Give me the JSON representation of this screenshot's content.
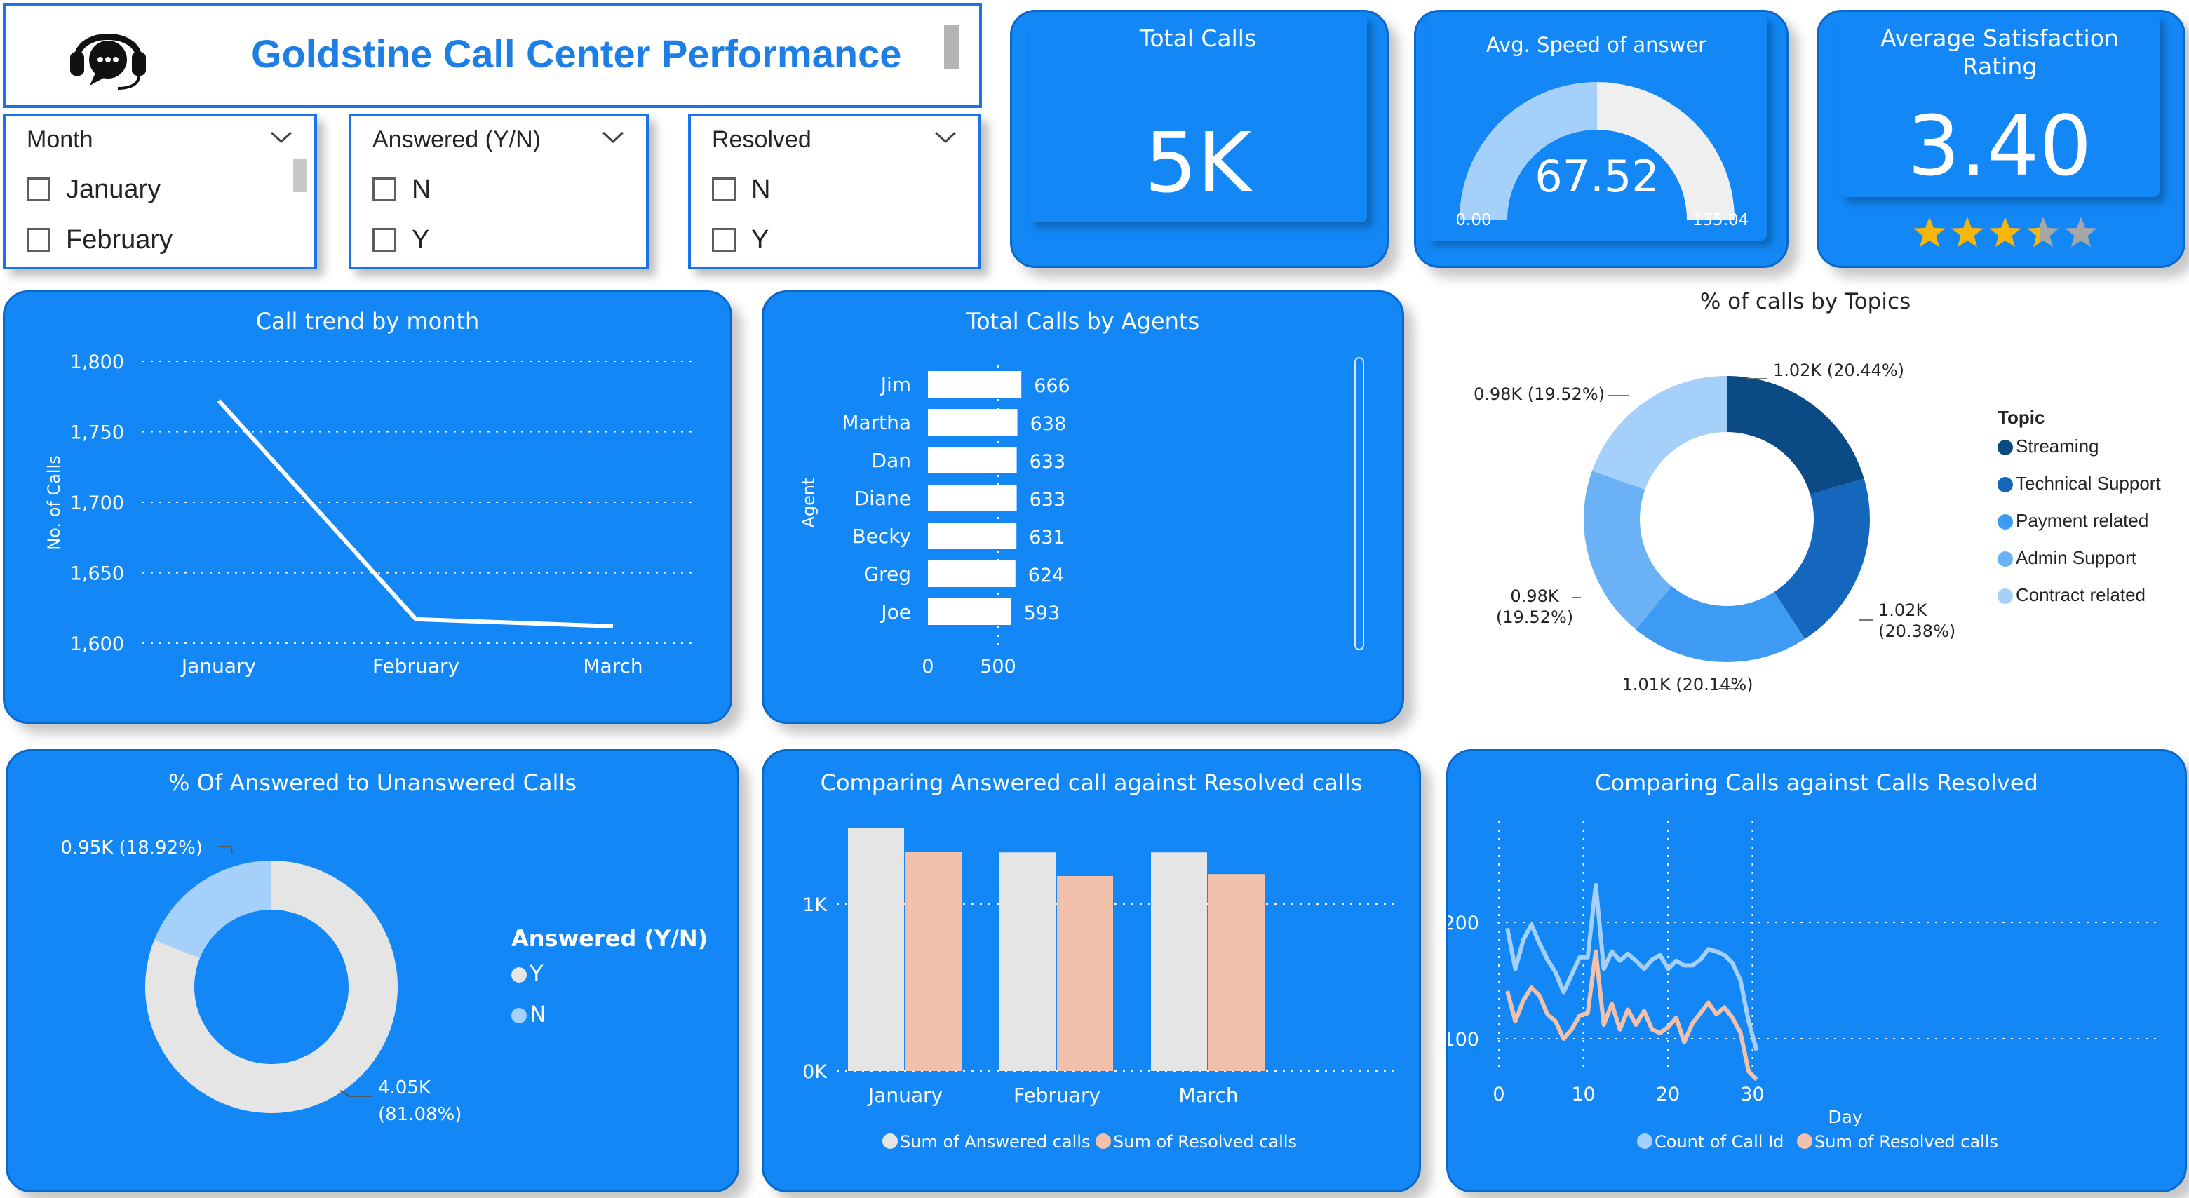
{
  "header": {
    "title": "Goldstine Call Center Performance",
    "logo_icon": "headset-chat-icon"
  },
  "slicers": {
    "month": {
      "title": "Month",
      "options": [
        "January",
        "February"
      ]
    },
    "answered": {
      "title": "Answered (Y/N)",
      "options": [
        "N",
        "Y"
      ]
    },
    "resolved": {
      "title": "Resolved",
      "options": [
        "N",
        "Y"
      ]
    }
  },
  "kpis": {
    "total_calls": {
      "title": "Total Calls",
      "value": "5K"
    },
    "speed": {
      "title": "Avg. Speed of answer",
      "value": "67.52",
      "min": "0.00",
      "max": "135.04",
      "fill_fraction": 0.5
    },
    "satisfaction": {
      "title_line1": "Average Satisfaction",
      "title_line2": "Rating",
      "value": "3.40",
      "stars_filled": 3.4,
      "stars_total": 5
    }
  },
  "colors": {
    "card_blue": "#1287f5",
    "streaming": "#0b4a84",
    "technical_support": "#1467bd",
    "payment_related": "#3e9bf3",
    "admin_support": "#6ab1f6",
    "contract_related": "#a5d0fa",
    "answered_y": "#e5e5e5",
    "answered_n": "#a5d0fa",
    "resolved_bar": "#f2c1ac",
    "count_line": "#a5d0fa",
    "resolved_line": "#f2c1ac",
    "star": "#f5b60e"
  },
  "chart_data": [
    {
      "id": "call_trend",
      "type": "line",
      "title": "Call trend by month",
      "ylabel": "No. of Calls",
      "categories": [
        "January",
        "February",
        "March"
      ],
      "values": [
        1772,
        1617,
        1612
      ],
      "yticks": [
        "1,600",
        "1,650",
        "1,700",
        "1,750",
        "1,800"
      ],
      "ylim": [
        1600,
        1800
      ],
      "grid": true
    },
    {
      "id": "calls_by_agent",
      "type": "bar",
      "orientation": "horizontal",
      "title": "Total Calls by Agents",
      "ylabel": "Agent",
      "categories": [
        "Jim",
        "Martha",
        "Dan",
        "Diane",
        "Becky",
        "Greg",
        "Joe"
      ],
      "values": [
        666,
        638,
        633,
        633,
        631,
        624,
        593
      ],
      "xticks": [
        "0",
        "500"
      ],
      "xlim": [
        0,
        666
      ]
    },
    {
      "id": "calls_by_topic",
      "type": "pie",
      "style": "donut",
      "title": "% of calls by Topics",
      "legend_title": "Topic",
      "categories": [
        "Streaming",
        "Technical Support",
        "Payment related",
        "Admin Support",
        "Contract related"
      ],
      "values": [
        20.44,
        20.38,
        20.14,
        19.52,
        19.52
      ],
      "labels": [
        "1.02K (20.44%)",
        "1.02K (20.38%)",
        "1.01K (20.14%)",
        "0.98K (19.52%)",
        "0.98K (19.52%)"
      ],
      "legend_position": "right"
    },
    {
      "id": "answered_share",
      "type": "pie",
      "style": "donut",
      "title": "% Of Answered to Unanswered Calls",
      "legend_title": "Answered (Y/N)",
      "categories": [
        "Y",
        "N"
      ],
      "values": [
        81.08,
        18.92
      ],
      "labels": [
        "4.05K (81.08%)",
        "0.95K (18.92%)"
      ],
      "legend_position": "right"
    },
    {
      "id": "answered_vs_resolved",
      "type": "bar",
      "title": "Comparing Answered call against Resolved calls",
      "categories": [
        "January",
        "February",
        "March"
      ],
      "series": [
        {
          "name": "Sum of Answered calls",
          "values": [
            1455,
            1310,
            1310
          ]
        },
        {
          "name": "Sum of Resolved calls",
          "values": [
            1312,
            1168,
            1180
          ]
        }
      ],
      "yticks": [
        "0K",
        "1K"
      ],
      "ylim": [
        0,
        1500
      ],
      "grid": true,
      "legend_position": "bottom"
    },
    {
      "id": "calls_vs_resolved_daily",
      "type": "line",
      "title": "Comparing Calls against Calls Resolved",
      "xlabel": "Day",
      "x": [
        1,
        2,
        3,
        4,
        5,
        6,
        7,
        8,
        9,
        10,
        11,
        12,
        13,
        14,
        15,
        16,
        17,
        18,
        19,
        20,
        21,
        22,
        23,
        24,
        25,
        26,
        27,
        28,
        29,
        30,
        31
      ],
      "series": [
        {
          "name": "Count of Call Id",
          "values": [
            195,
            160,
            185,
            198,
            182,
            168,
            157,
            140,
            155,
            170,
            170,
            232,
            160,
            175,
            167,
            173,
            167,
            160,
            168,
            172,
            160,
            167,
            163,
            163,
            168,
            177,
            175,
            172,
            165,
            150,
            115,
            90
          ]
        },
        {
          "name": "Sum of Resolved calls",
          "values": [
            141,
            115,
            133,
            144,
            137,
            121,
            115,
            100,
            108,
            120,
            122,
            175,
            112,
            130,
            108,
            125,
            112,
            124,
            108,
            105,
            110,
            118,
            97,
            113,
            122,
            131,
            121,
            127,
            118,
            105,
            72,
            65
          ]
        }
      ],
      "xticks": [
        "0",
        "10",
        "20",
        "30"
      ],
      "yticks": [
        "100",
        "200"
      ],
      "grid": true,
      "legend_position": "bottom"
    }
  ]
}
